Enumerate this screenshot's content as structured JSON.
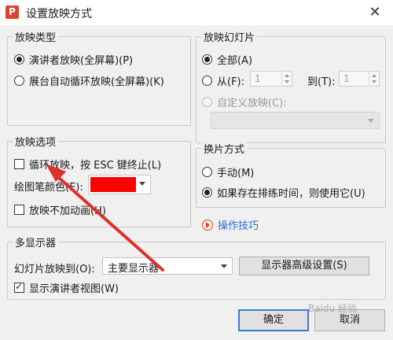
{
  "window": {
    "title": "设置放映方式",
    "app_icon_glyph": "P",
    "close_glyph": "✕"
  },
  "show_type": {
    "legend": "放映类型",
    "options": [
      {
        "label": "演讲者放映(全屏幕)(P)",
        "selected": true
      },
      {
        "label": "展台自动循环放映(全屏幕)(K)",
        "selected": false
      }
    ]
  },
  "slides": {
    "legend": "放映幻灯片",
    "all_label": "全部(A)",
    "from_label": "从(F):",
    "from_value": "1",
    "to_label": "到(T):",
    "to_value": "1",
    "custom_label": "自定义放映(C):",
    "custom_value": ""
  },
  "options": {
    "legend": "放映选项",
    "loop_label": "循环放映，按 ESC 键终止(L)",
    "pen_color_label": "绘图笔颜色(E):",
    "pen_color": "#ff0000",
    "no_animation_label": "放映不加动画(H)"
  },
  "advance": {
    "legend": "换片方式",
    "manual_label": "手动(M)",
    "timing_label": "如果存在排练时间，则使用它(U)"
  },
  "tips_link": "操作技巧",
  "monitors": {
    "legend": "多显示器",
    "play_on_label": "幻灯片放映到(O):",
    "play_on_value": "主要显示器",
    "advanced_button": "显示器高级设置(S)",
    "presenter_view_label": "显示演讲者视图(W)"
  },
  "buttons": {
    "ok": "确定",
    "cancel": "取消"
  },
  "watermark": "Baidu 经验",
  "annotation_color": "#e0302a"
}
